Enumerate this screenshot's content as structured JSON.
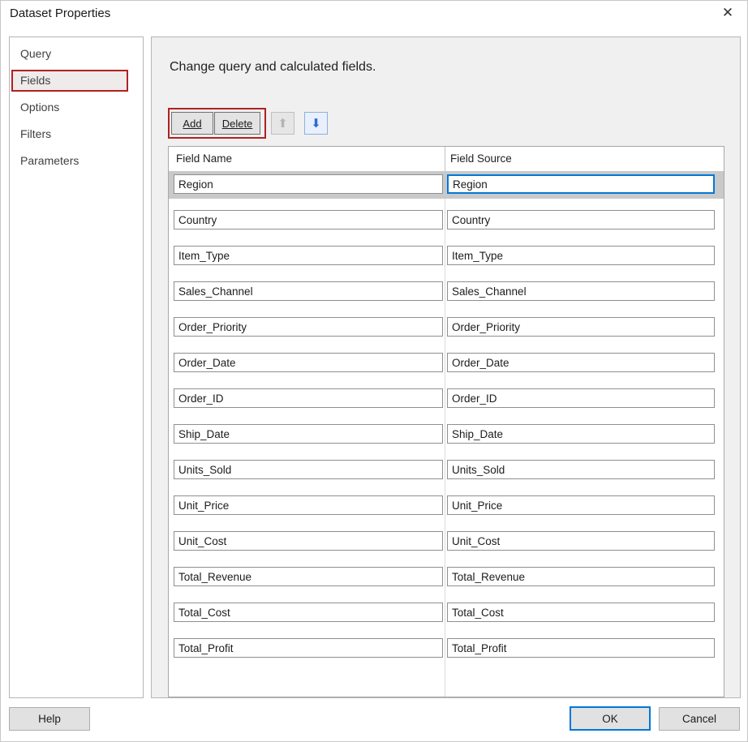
{
  "window": {
    "title": "Dataset Properties",
    "close_icon": "✕"
  },
  "sidebar": {
    "items": [
      {
        "label": "Query"
      },
      {
        "label": "Fields"
      },
      {
        "label": "Options"
      },
      {
        "label": "Filters"
      },
      {
        "label": "Parameters"
      }
    ],
    "selected": "Fields"
  },
  "main": {
    "heading": "Change query and calculated fields.",
    "toolbar": {
      "add_label": "Add",
      "delete_label": "Delete",
      "move_up_icon": "⬆",
      "move_down_icon": "⬇"
    },
    "table": {
      "columns": [
        "Field Name",
        "Field Source"
      ],
      "selected_row": "Region",
      "rows": [
        {
          "name": "Region",
          "source": "Region"
        },
        {
          "name": "Country",
          "source": "Country"
        },
        {
          "name": "Item_Type",
          "source": "Item_Type"
        },
        {
          "name": "Sales_Channel",
          "source": "Sales_Channel"
        },
        {
          "name": "Order_Priority",
          "source": "Order_Priority"
        },
        {
          "name": "Order_Date",
          "source": "Order_Date"
        },
        {
          "name": "Order_ID",
          "source": "Order_ID"
        },
        {
          "name": "Ship_Date",
          "source": "Ship_Date"
        },
        {
          "name": "Units_Sold",
          "source": "Units_Sold"
        },
        {
          "name": "Unit_Price",
          "source": "Unit_Price"
        },
        {
          "name": "Unit_Cost",
          "source": "Unit_Cost"
        },
        {
          "name": "Total_Revenue",
          "source": "Total_Revenue"
        },
        {
          "name": "Total_Cost",
          "source": "Total_Cost"
        },
        {
          "name": "Total_Profit",
          "source": "Total_Profit"
        }
      ]
    }
  },
  "footer": {
    "help_label": "Help",
    "ok_label": "OK",
    "cancel_label": "Cancel"
  },
  "colors": {
    "accent_blue": "#0078d7",
    "annotation_red": "#b02121",
    "selected_row_gray": "#c9c9c9",
    "panel_gray": "#f0f0f0"
  }
}
